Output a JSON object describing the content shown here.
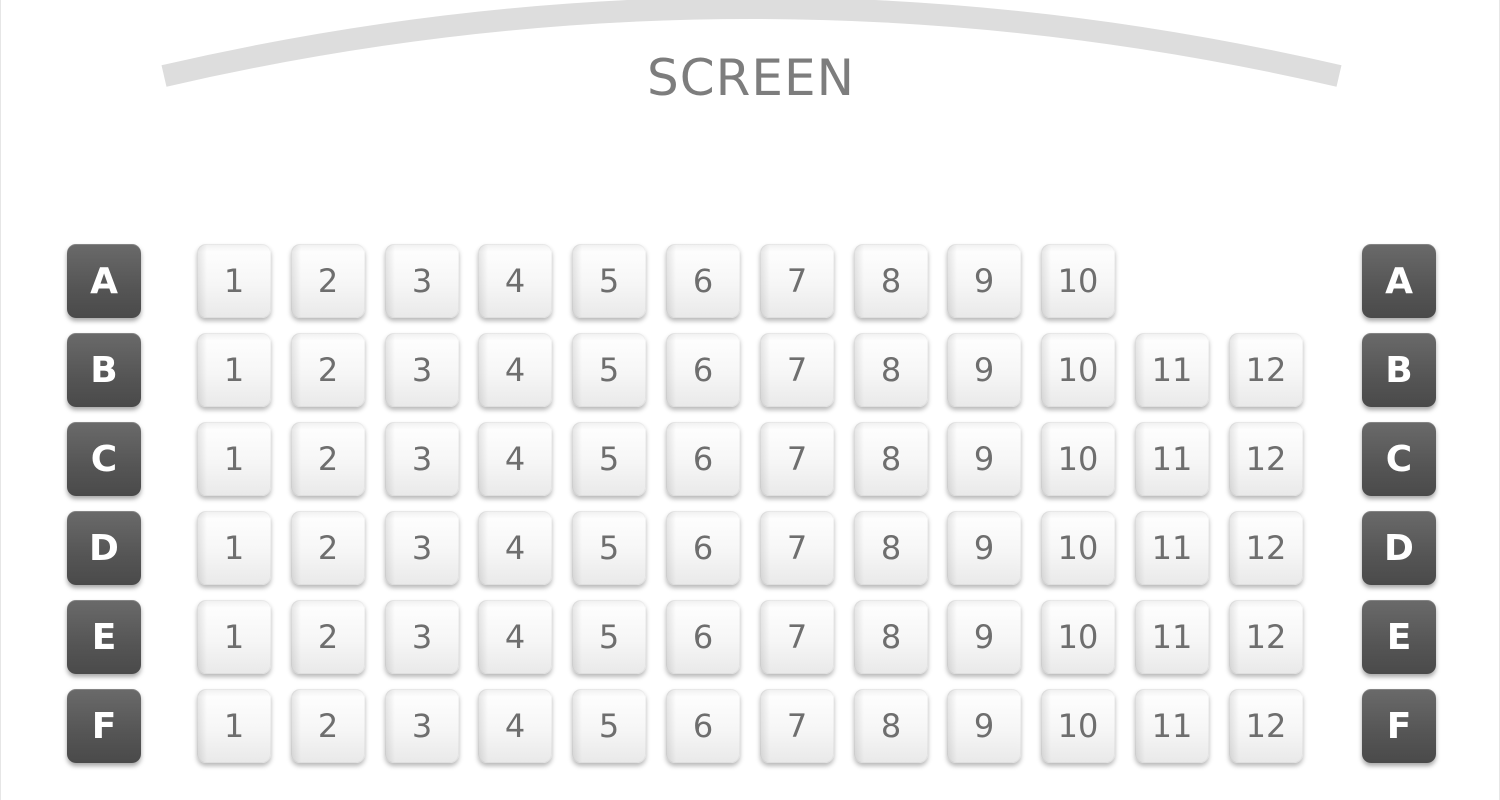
{
  "screen": {
    "label": "SCREEN",
    "arc_color": "#dddddd"
  },
  "colors": {
    "row_label_bg": "#555555",
    "row_label_text": "#ffffff",
    "seat_bg": "#f6f6f6",
    "seat_text": "#6e6e6e"
  },
  "rows": [
    {
      "label": "A",
      "seats": [
        "1",
        "2",
        "3",
        "4",
        "5",
        "6",
        "7",
        "8",
        "9",
        "10"
      ]
    },
    {
      "label": "B",
      "seats": [
        "1",
        "2",
        "3",
        "4",
        "5",
        "6",
        "7",
        "8",
        "9",
        "10",
        "11",
        "12"
      ]
    },
    {
      "label": "C",
      "seats": [
        "1",
        "2",
        "3",
        "4",
        "5",
        "6",
        "7",
        "8",
        "9",
        "10",
        "11",
        "12"
      ]
    },
    {
      "label": "D",
      "seats": [
        "1",
        "2",
        "3",
        "4",
        "5",
        "6",
        "7",
        "8",
        "9",
        "10",
        "11",
        "12"
      ]
    },
    {
      "label": "E",
      "seats": [
        "1",
        "2",
        "3",
        "4",
        "5",
        "6",
        "7",
        "8",
        "9",
        "10",
        "11",
        "12"
      ]
    },
    {
      "label": "F",
      "seats": [
        "1",
        "2",
        "3",
        "4",
        "5",
        "6",
        "7",
        "8",
        "9",
        "10",
        "11",
        "12"
      ]
    }
  ]
}
